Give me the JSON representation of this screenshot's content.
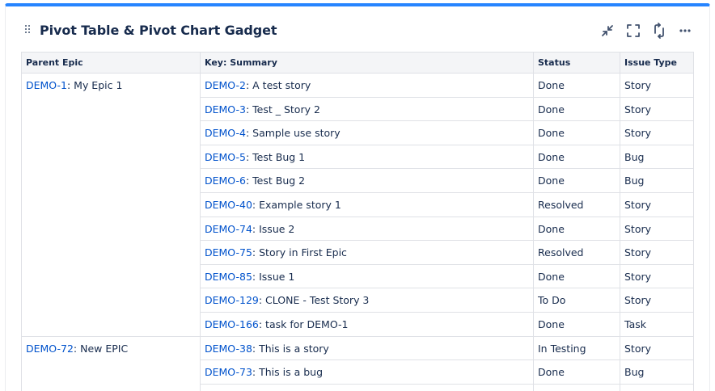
{
  "gadget": {
    "title": "Pivot Table & Pivot Chart Gadget",
    "accent": "#2684ff",
    "link_color": "#0052cc",
    "icons": [
      "collapse-icon",
      "fullscreen-icon",
      "refresh-icon",
      "more-icon"
    ]
  },
  "table": {
    "headers": [
      "Parent Epic",
      "Key: Summary",
      "Status",
      "Issue Type"
    ],
    "groups": [
      {
        "epic_key": "DEMO-1",
        "epic_name": ": My Epic 1",
        "rows": [
          {
            "key": "DEMO-2",
            "summary": ": A test story",
            "status": "Done",
            "type": "Story"
          },
          {
            "key": "DEMO-3",
            "summary": ": Test _ Story 2",
            "status": "Done",
            "type": "Story"
          },
          {
            "key": "DEMO-4",
            "summary": ": Sample use story",
            "status": "Done",
            "type": "Story"
          },
          {
            "key": "DEMO-5",
            "summary": ": Test Bug 1",
            "status": "Done",
            "type": "Bug"
          },
          {
            "key": "DEMO-6",
            "summary": ": Test Bug 2",
            "status": "Done",
            "type": "Bug"
          },
          {
            "key": "DEMO-40",
            "summary": ": Example story 1",
            "status": "Resolved",
            "type": "Story"
          },
          {
            "key": "DEMO-74",
            "summary": ": Issue 2",
            "status": "Done",
            "type": "Story"
          },
          {
            "key": "DEMO-75",
            "summary": ": Story in First Epic",
            "status": "Resolved",
            "type": "Story"
          },
          {
            "key": "DEMO-85",
            "summary": ": Issue 1",
            "status": "Done",
            "type": "Story"
          },
          {
            "key": "DEMO-129",
            "summary": ": CLONE - Test Story 3",
            "status": "To Do",
            "type": "Story"
          },
          {
            "key": "DEMO-166",
            "summary": ": task for DEMO-1",
            "status": "Done",
            "type": "Task"
          }
        ]
      },
      {
        "epic_key": "DEMO-72",
        "epic_name": ": New EPIC",
        "rows": [
          {
            "key": "DEMO-38",
            "summary": ": This is a story",
            "status": "In Testing",
            "type": "Story"
          },
          {
            "key": "DEMO-73",
            "summary": ": This is a bug",
            "status": "Done",
            "type": "Bug"
          },
          {
            "key": "",
            "summary": "",
            "status": "",
            "type": ""
          }
        ]
      }
    ]
  }
}
